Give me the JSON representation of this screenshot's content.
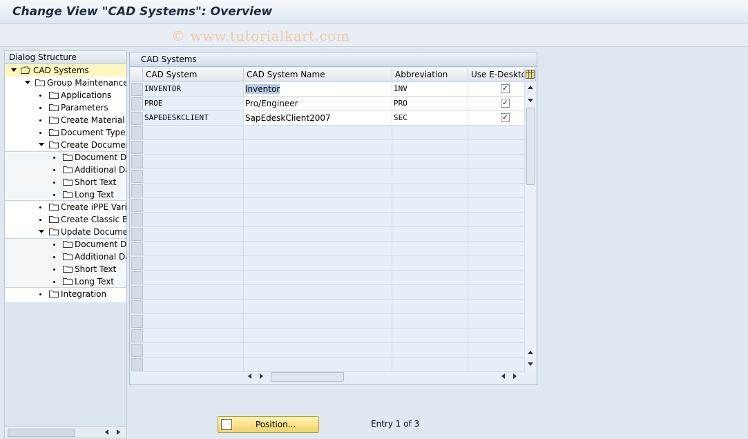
{
  "window": {
    "title": "Change View \"CAD Systems\": Overview"
  },
  "watermark": "© www.tutorialkart.com",
  "dialog_structure": {
    "header": "Dialog Structure",
    "nodes": [
      {
        "label": "CAD Systems"
      },
      {
        "label": "Group Maintenance"
      },
      {
        "label": "Applications"
      },
      {
        "label": "Parameters"
      },
      {
        "label": "Create Material"
      },
      {
        "label": "Document Type"
      },
      {
        "label": "Create Documen"
      },
      {
        "label": "Document Da"
      },
      {
        "label": "Additional Dat"
      },
      {
        "label": "Short Text"
      },
      {
        "label": "Long Text"
      },
      {
        "label": "Create iPPE Varia"
      },
      {
        "label": "Create Classic BO"
      },
      {
        "label": "Update Documer"
      },
      {
        "label": "Document Da"
      },
      {
        "label": "Additional Dat"
      },
      {
        "label": "Short Text"
      },
      {
        "label": "Long Text"
      },
      {
        "label": "Integration"
      }
    ]
  },
  "table": {
    "title": "CAD Systems",
    "columns": [
      "CAD System",
      "CAD System Name",
      "Abbreviation",
      "Use E-Desktop"
    ],
    "rows": [
      {
        "cad_system": "INVENTOR",
        "name": "Inventor",
        "abbr": "INV",
        "edesktop": "✓"
      },
      {
        "cad_system": "PROE",
        "name": "Pro/Engineer",
        "abbr": "PRO",
        "edesktop": "✓"
      },
      {
        "cad_system": "SAPEDESKCLIENT",
        "name": "SapEdeskClient2007",
        "abbr": "SEC",
        "edesktop": "✓"
      }
    ]
  },
  "footer": {
    "position_button": "Position...",
    "entry_text": "Entry 1 of 3"
  }
}
